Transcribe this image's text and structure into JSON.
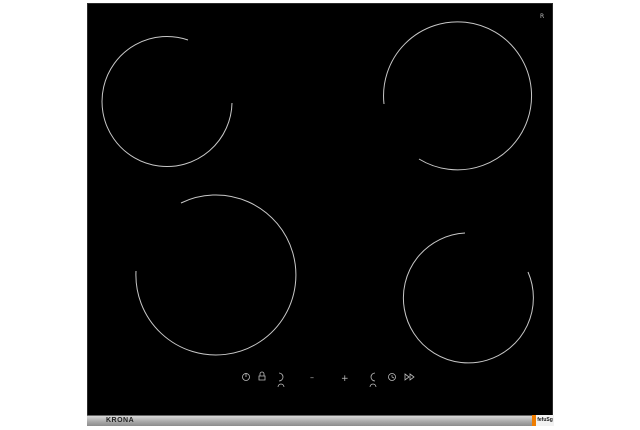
{
  "product": {
    "brand": "KRONA",
    "label_tag": "fefuSg",
    "corner_mark": "R"
  },
  "controls": {
    "minus": "–",
    "plus": "+"
  },
  "colors": {
    "glass": "#000000",
    "burner_ring": "#c8c8c8",
    "trim": "#b5b5b5",
    "tag_accent": "#ef7d00",
    "background": "#ffffff"
  }
}
